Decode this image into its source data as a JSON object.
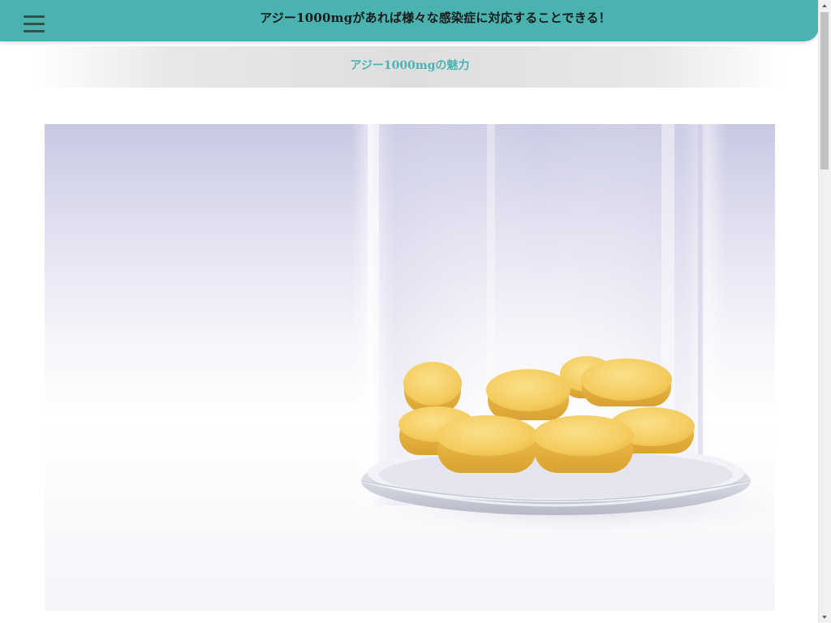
{
  "header": {
    "site_title": "アジー1000mgがあれば様々な感染症に対応することできる！",
    "menu_icon": "hamburger-menu-icon",
    "background_color": "#4bb3af"
  },
  "subtitle": {
    "text": "アジー1000mgの魅力",
    "color": "#4bb3af"
  },
  "hero": {
    "image_subject": "yellow tablets in a glass dish"
  },
  "scrollbar": {
    "thumb_color": "#c1c1c1"
  }
}
